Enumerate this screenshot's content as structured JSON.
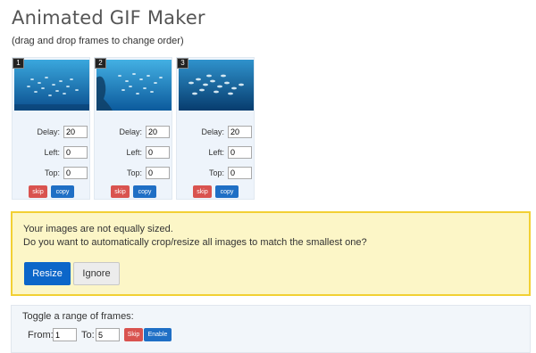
{
  "header": {
    "title": "Animated GIF Maker",
    "subtitle": "(drag and drop frames to change order)"
  },
  "frames": [
    {
      "number": "1",
      "delay_label": "Delay:",
      "delay": "20",
      "left_label": "Left:",
      "left": "0",
      "top_label": "Top:",
      "top": "0",
      "skip_label": "skip",
      "copy_label": "copy"
    },
    {
      "number": "2",
      "delay_label": "Delay:",
      "delay": "20",
      "left_label": "Left:",
      "left": "0",
      "top_label": "Top:",
      "top": "0",
      "skip_label": "skip",
      "copy_label": "copy"
    },
    {
      "number": "3",
      "delay_label": "Delay:",
      "delay": "20",
      "left_label": "Left:",
      "left": "0",
      "top_label": "Top:",
      "top": "0",
      "skip_label": "skip",
      "copy_label": "copy"
    }
  ],
  "alert": {
    "line1": "Your images are not equally sized.",
    "line2": "Do you want to automatically crop/resize all images to match the smallest one?",
    "resize_label": "Resize",
    "ignore_label": "Ignore"
  },
  "toggle": {
    "title": "Toggle a range of frames:",
    "from_label": "From:",
    "from_value": "1",
    "to_label": "To:",
    "to_value": "5",
    "skip_label": "Skip",
    "enable_label": "Enable"
  },
  "colors": {
    "skip": "#d9534f",
    "copy": "#1f6fc5",
    "primary": "#0c66c9",
    "alert_bg": "#fcf6c7",
    "alert_border": "#f2d033"
  }
}
